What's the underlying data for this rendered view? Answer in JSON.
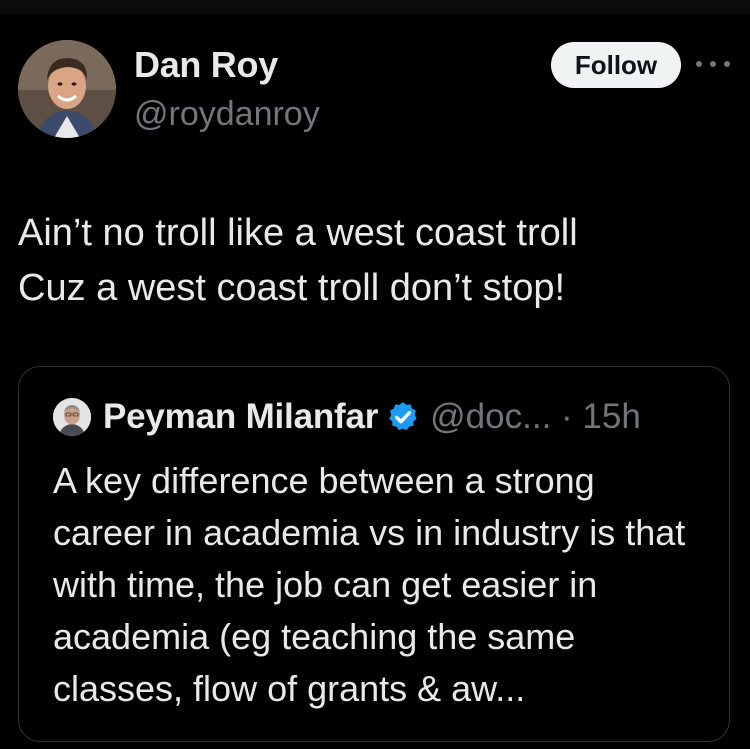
{
  "post": {
    "author": {
      "name": "Dan Roy",
      "handle": "@roydanroy"
    },
    "follow_label": "Follow",
    "text": "Ain’t no troll like a west coast troll\nCuz a west coast troll don’t stop!"
  },
  "quoted_post": {
    "author": {
      "name": "Peyman Milanfar",
      "handle_time": "@doc... · 15h",
      "verified": true
    },
    "text": "A key difference between a strong career in academia vs in industry is that with time, the job can get easier in academia (eg teaching the same classes, flow of grants & aw..."
  },
  "colors": {
    "background": "#000000",
    "text_primary": "#e7e9ea",
    "text_secondary": "#71767b",
    "verified_blue": "#1d9bf0",
    "button_bg": "#eff3f4",
    "border": "#2f3336"
  },
  "icons": [
    "more-icon",
    "verified-badge-icon"
  ]
}
